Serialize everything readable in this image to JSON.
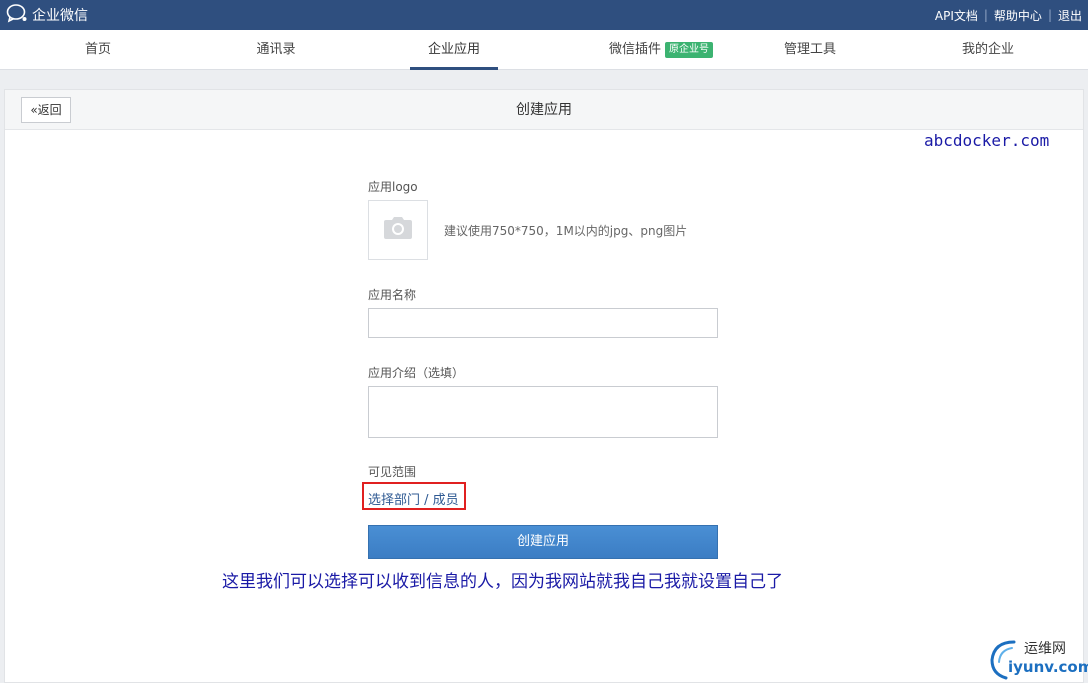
{
  "topbar": {
    "brand": "企业微信",
    "links": [
      "API文档",
      "帮助中心",
      "退出"
    ]
  },
  "nav": {
    "items": [
      {
        "label": "首页"
      },
      {
        "label": "通讯录"
      },
      {
        "label": "企业应用",
        "active": true
      },
      {
        "label": "微信插件",
        "badge": "原企业号"
      },
      {
        "label": "管理工具"
      },
      {
        "label": "我的企业"
      }
    ]
  },
  "panel": {
    "back_label": "返回",
    "title": "创建应用"
  },
  "form": {
    "logo_label": "应用logo",
    "logo_hint": "建议使用750*750，1M以内的jpg、png图片",
    "name_label": "应用名称",
    "name_value": "",
    "desc_label": "应用介绍（选填）",
    "desc_value": "",
    "range_label": "可见范围",
    "range_link": "选择部门 / 成员",
    "submit_label": "创建应用"
  },
  "overlays": {
    "watermark_top": "abcdocker.com",
    "annotation": "这里我们可以选择可以收到信息的人，因为我网站就我自己我就设置自己了",
    "site_mark_cn": "运维网",
    "site_mark_en": "iyunv.com"
  },
  "colors": {
    "topbar": "#2f4f7f",
    "badge": "#3cb371",
    "link": "#2f5a93",
    "highlight_box": "#e02020",
    "button": "#3b7dc4",
    "annotation": "#1a1aa6"
  },
  "icons": {
    "brand": "chat-bubble-icon",
    "back": "double-chevron-left-icon",
    "logo_upload": "camera-icon"
  }
}
